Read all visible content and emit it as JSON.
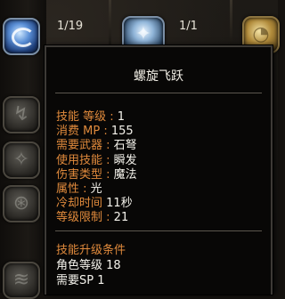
{
  "skill_grid": {
    "top_counts": [
      "1/19",
      "1/1"
    ]
  },
  "tooltip": {
    "title": "螺旋飞跃",
    "stats": [
      {
        "key": "技能 等级",
        "sep": " : ",
        "value": "1"
      },
      {
        "key": "消费 MP",
        "sep": " : ",
        "value": "155"
      },
      {
        "key": "需要武器",
        "sep": " : ",
        "value": "石弩"
      },
      {
        "key": "使用技能",
        "sep": " : ",
        "value": "瞬发"
      },
      {
        "key": "伤害类型",
        "sep": " : ",
        "value": "魔法"
      },
      {
        "key": "属性",
        "sep": " : ",
        "value": "光"
      },
      {
        "key": "冷却时间",
        "sep": " ",
        "value": "11秒"
      },
      {
        "key": "等级限制",
        "sep": " : ",
        "value": "21"
      }
    ],
    "upgrade_title": "技能升级条件",
    "requirements": [
      "角色等级 18",
      "需要SP 1"
    ]
  },
  "colors": {
    "key": "#e08a3c",
    "value": "#f5f3ec",
    "tooltip_bg": "#080706"
  },
  "icons": [
    "swirl-skill-icon",
    "frost-skill-icon",
    "gold-skill-icon"
  ]
}
